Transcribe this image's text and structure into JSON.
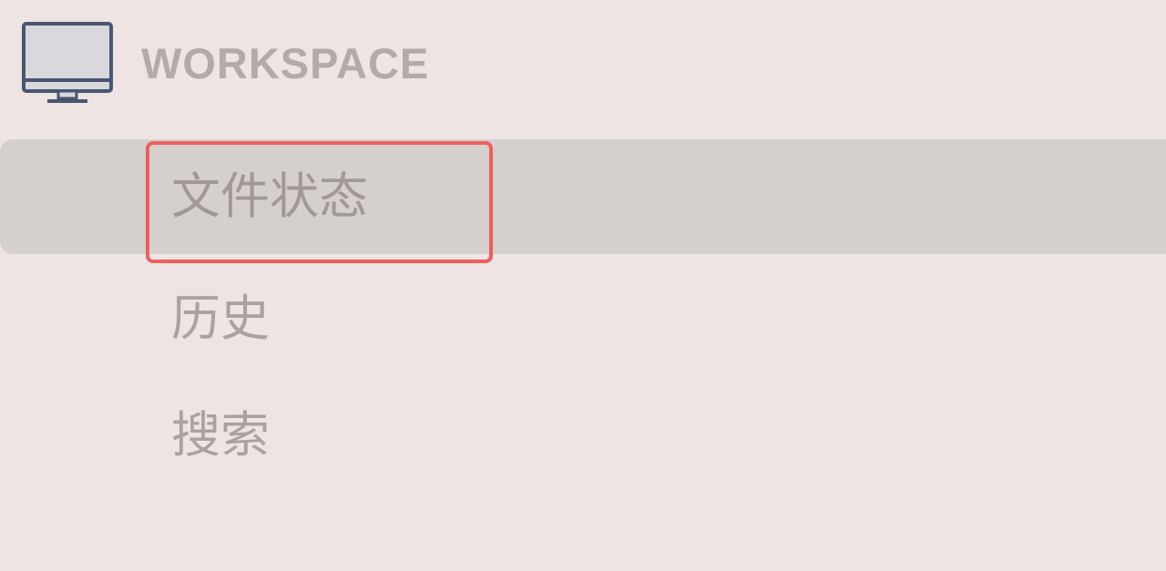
{
  "sidebar": {
    "section": {
      "title": "WORKSPACE",
      "icon": "monitor-icon"
    },
    "items": [
      {
        "label": "文件状态",
        "selected": true
      },
      {
        "label": "历史",
        "selected": false
      },
      {
        "label": "搜索",
        "selected": false
      }
    ]
  },
  "colors": {
    "background": "#ede4e3",
    "selected_row": "#d5d0cd",
    "text_muted": "#aaa1a0",
    "icon_stroke": "#4a5670",
    "icon_fill": "#d8d8dd",
    "highlight": "#ec5f5e"
  }
}
